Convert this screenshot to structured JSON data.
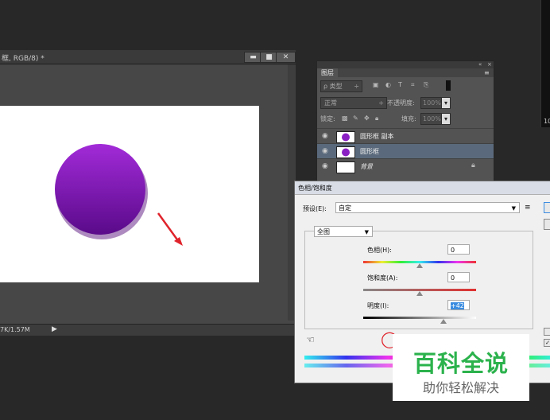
{
  "document": {
    "title": "框, RGB/8) *",
    "minimize": "▬",
    "maximize": "■",
    "close": "✕",
    "status": "7K/1.57M",
    "status_arrow": "▶"
  },
  "layers_panel": {
    "tab": "图层",
    "filter_label": "ρ 类型",
    "blend_mode": "正常",
    "opacity_label": "不透明度:",
    "opacity_value": "100%",
    "lock_label": "锁定:",
    "fill_label": "填充:",
    "fill_value": "100%",
    "layers": [
      {
        "name": "圆形框 副本",
        "selected": false
      },
      {
        "name": "圆形框",
        "selected": true
      },
      {
        "name": "背景",
        "selected": false
      }
    ]
  },
  "dialog": {
    "title": "色相/饱和度",
    "preset_label": "预设(E):",
    "preset_value": "自定",
    "channel": "全图",
    "hue_label": "色相(H):",
    "hue_value": "0",
    "saturation_label": "饱和度(A):",
    "saturation_value": "0",
    "lightness_label": "明度(I):",
    "lightness_value": "+42"
  },
  "watermark": {
    "title": "百科全说",
    "subtitle": "助你轻松解决"
  },
  "right_strip_label": "10",
  "colors": {
    "circle_top": "#a22bd8",
    "circle_bottom": "#5a0a8a",
    "arrow": "#e0242c",
    "selected_layer": "#5a6a7c",
    "watermark_green": "#2bb24c"
  }
}
